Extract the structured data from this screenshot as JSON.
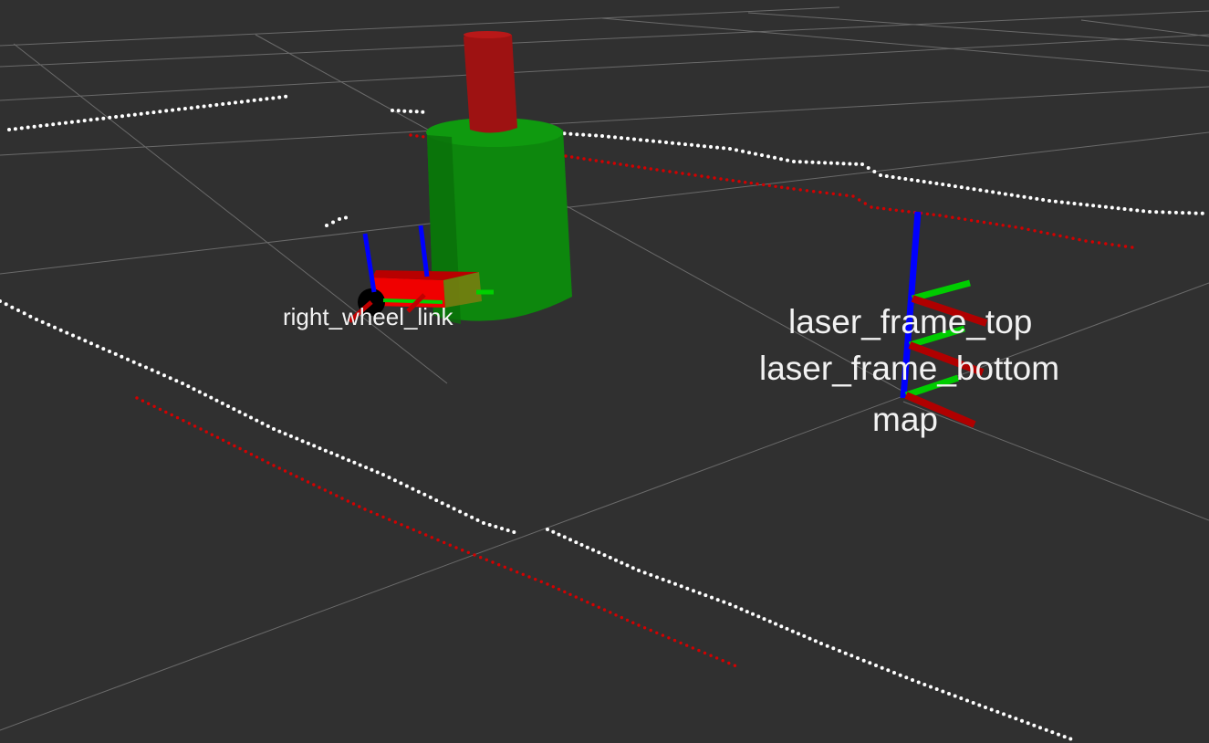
{
  "view": {
    "background": "#303030",
    "grid_color": "#a0a0a0"
  },
  "frames": {
    "right_wheel_link": "right_wheel_link",
    "laser_frame_top": "laser_frame_top",
    "laser_frame_bottom": "laser_frame_bottom",
    "map": "map"
  },
  "colors": {
    "scan_top": "#ffffff",
    "scan_bottom": "#d40000",
    "robot_body": "#e00000",
    "robot_cylinder": "#0a8a0a",
    "robot_mast": "#a01010",
    "axis_x": "#c00000",
    "axis_y": "#00c000",
    "axis_z": "#0000ff"
  }
}
